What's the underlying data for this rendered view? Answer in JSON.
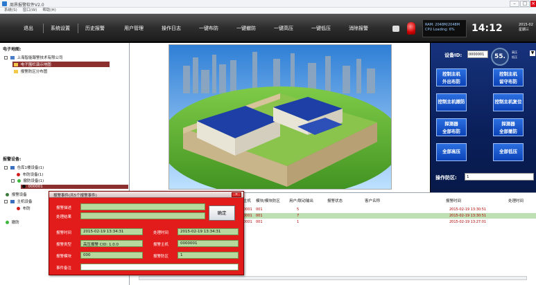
{
  "window": {
    "title": "周界报警软件V2.0",
    "minimize": "–",
    "restore": "□",
    "close": "×"
  },
  "menu": [
    "系统(S)",
    "窗口(W)",
    "帮助(H)"
  ],
  "toolbar": {
    "items": [
      "退出",
      "系统设置",
      "历史报警",
      "用户管理",
      "操作日志",
      "一键布防",
      "一键撤防",
      "一键高压",
      "一键低压",
      "消除报警"
    ],
    "status_line1": "RAM: 2048M/2048M",
    "status_line2": "CPU Loading: 6%",
    "clock": "14:12",
    "date_line1": "2015-02",
    "date_line2": "星期三"
  },
  "left": {
    "map_title": "电子地图:",
    "map_company": "上海智能報警技术有限公司",
    "map_item1": "电子围栏演示地图",
    "map_item2": "报警防区分布图",
    "device_title": "报警设备:",
    "device_root": "仓库1楼设备(1)",
    "device_child1": "布防设备(1)",
    "device_child2": "撤防设备(1)",
    "device_leaf": "000001",
    "device_group2": "报警设备",
    "device_root2": "主机设备",
    "device_child3": "布防",
    "device_child4": "撤防"
  },
  "right": {
    "device_id_label": "设备ID:",
    "device_id_value": "0000001",
    "gauge": "55.",
    "dd1": "高压",
    "dd2": "低压",
    "btn1_l1": "控制主机",
    "btn1_l2": "外出布防",
    "btn2_l1": "控制主机",
    "btn2_l2": "留守布防",
    "btn3": "控制主机撤防",
    "btn4": "控制主机复位",
    "btn5_l1": "探测器",
    "btn5_l2": "全部布防",
    "btn6_l1": "探测器",
    "btn6_l2": "全部撤防",
    "btn7": "全部高压",
    "btn8": "全部低压",
    "zone_label": "操作防区:",
    "zone_value": "1"
  },
  "table": {
    "headers": [
      "主机",
      "模块/模块防区",
      "用户/联动输出",
      "报警状态",
      "客户名称",
      "报警时间",
      "处理时间"
    ],
    "rows": [
      {
        "host": "0001",
        "module": "001",
        "user": "5",
        "time": "2015-02-19 13:30:51"
      },
      {
        "host": "0001",
        "module": "001",
        "user": "7",
        "time": "2015-02-19 13:30:51"
      },
      {
        "host": "0001",
        "module": "001",
        "user": "1",
        "time": "2015-02-19 13:27:01"
      }
    ]
  },
  "dialog": {
    "title": "报警事件(共5个报警事件)",
    "close": "×",
    "label1": "报警描述",
    "label2": "处理结果",
    "ok": "确定",
    "start_label": "报警时间",
    "start_value": "2015-02-19 13:34:31",
    "end_label": "处理时间",
    "end_value": "2015-02-19 13:34:31",
    "type_label": "报警类型",
    "type_value": "高压报警 CID: 1.0.0",
    "host_label": "报警主机",
    "host_value": "0000001",
    "zone_label": "报警模块",
    "zone_value": "000",
    "addr_label": "报警防区",
    "addr_value": "1",
    "remark_label": "事件备注",
    "remark_value": ""
  }
}
